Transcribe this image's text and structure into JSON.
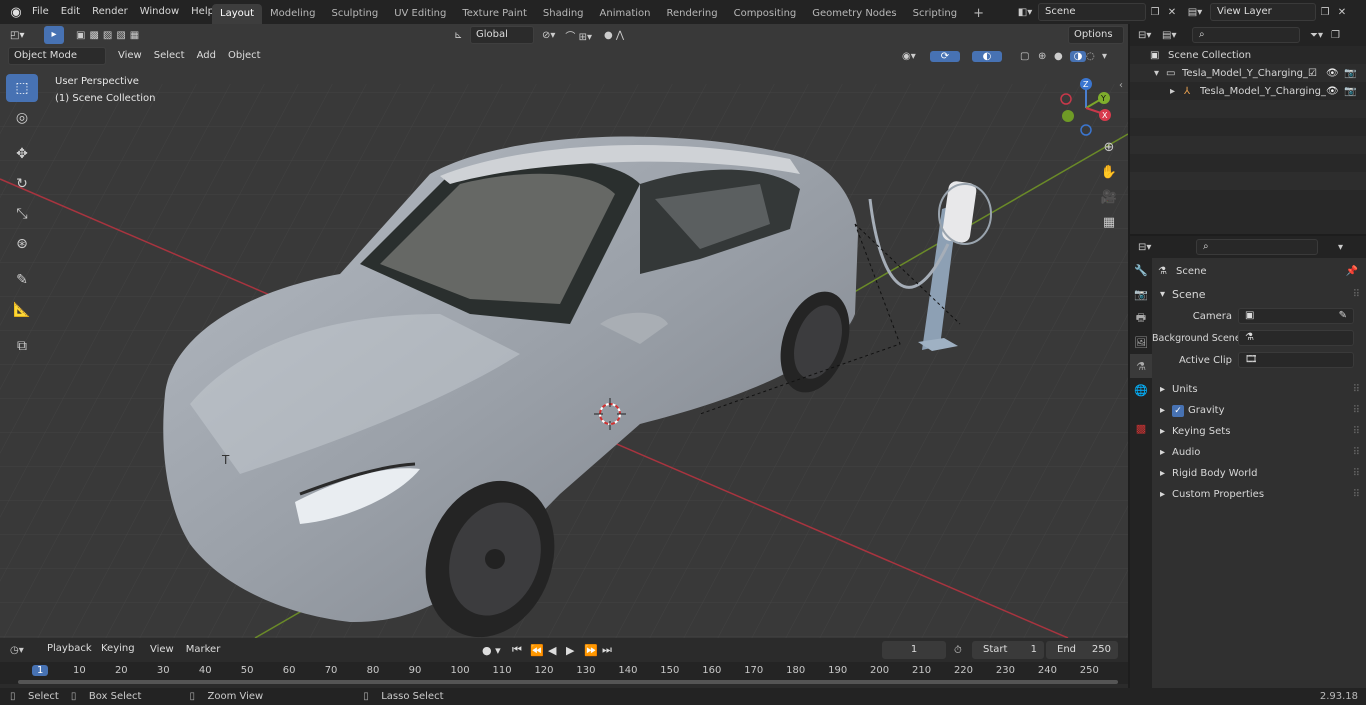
{
  "topbar": {
    "menus": [
      "File",
      "Edit",
      "Render",
      "Window",
      "Help"
    ],
    "workspaces": [
      "Layout",
      "Modeling",
      "Sculpting",
      "UV Editing",
      "Texture Paint",
      "Shading",
      "Animation",
      "Rendering",
      "Compositing",
      "Geometry Nodes",
      "Scripting"
    ],
    "active_workspace": "Layout",
    "scene_name": "Scene",
    "view_layer": "View Layer"
  },
  "viewport": {
    "mode": "Object Mode",
    "menus": [
      "View",
      "Select",
      "Add",
      "Object"
    ],
    "transform_orientation": "Global",
    "options_label": "Options",
    "perspective_label": "User Perspective",
    "collection_label": "(1) Scene Collection",
    "gizmo": {
      "x": "X",
      "y": "Y",
      "z": "Z"
    }
  },
  "outliner": {
    "root": "Scene Collection",
    "items": [
      {
        "label": "Tesla_Model_Y_Charging_with"
      },
      {
        "label": "Tesla_Model_Y_Charging_"
      }
    ]
  },
  "properties": {
    "header": "Scene",
    "section": "Scene",
    "fields": [
      {
        "label": "Camera"
      },
      {
        "label": "Background Scene"
      },
      {
        "label": "Active Clip"
      }
    ],
    "panels": [
      "Units",
      "Gravity",
      "Keying Sets",
      "Audio",
      "Rigid Body World",
      "Custom Properties"
    ],
    "gravity_checked": true
  },
  "timeline": {
    "menus": [
      "Playback",
      "Keying",
      "View",
      "Marker"
    ],
    "current_frame": "1",
    "start_label": "Start",
    "start_value": "1",
    "end_label": "End",
    "end_value": "250",
    "ruler": [
      "1",
      "10",
      "20",
      "30",
      "40",
      "50",
      "60",
      "70",
      "80",
      "90",
      "100",
      "110",
      "120",
      "130",
      "140",
      "150",
      "160",
      "170",
      "180",
      "190",
      "200",
      "210",
      "220",
      "230",
      "240",
      "250"
    ]
  },
  "statusbar": {
    "select": "Select",
    "box_select": "Box Select",
    "zoom_view": "Zoom View",
    "lasso_select": "Lasso Select",
    "version": "2.93.18"
  }
}
